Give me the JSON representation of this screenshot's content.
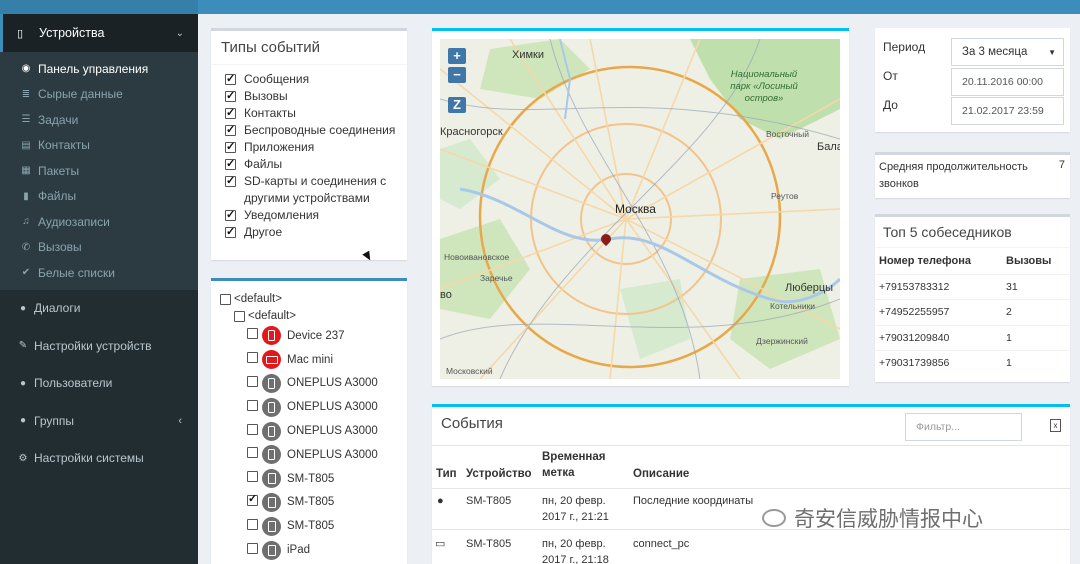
{
  "sidebar": {
    "header": {
      "label": "Устройства"
    },
    "sub_items": [
      {
        "label": "Панель управления",
        "icon": "dashboard-icon",
        "active": true
      },
      {
        "label": "Сырые данные",
        "icon": "database-icon"
      },
      {
        "label": "Задачи",
        "icon": "tasks-icon"
      },
      {
        "label": "Контакты",
        "icon": "contacts-icon"
      },
      {
        "label": "Пакеты",
        "icon": "packages-icon"
      },
      {
        "label": "Файлы",
        "icon": "file-icon"
      },
      {
        "label": "Аудиозаписи",
        "icon": "music-icon"
      },
      {
        "label": "Вызовы",
        "icon": "phone-icon"
      },
      {
        "label": "Белые списки",
        "icon": "check-icon"
      }
    ],
    "items": [
      {
        "label": "Диалоги",
        "icon": "comments-icon"
      },
      {
        "label": "Настройки устройств",
        "icon": "edit-icon"
      },
      {
        "label": "Пользователи",
        "icon": "user-icon"
      },
      {
        "label": "Группы",
        "icon": "users-icon"
      },
      {
        "label": "Настройки системы",
        "icon": "gear-icon"
      }
    ]
  },
  "event_types": {
    "title": "Типы событий",
    "items": [
      {
        "label": "Сообщения",
        "checked": true
      },
      {
        "label": "Вызовы",
        "checked": true
      },
      {
        "label": "Контакты",
        "checked": true
      },
      {
        "label": "Беспроводные соединения",
        "checked": true
      },
      {
        "label": "Приложения",
        "checked": true
      },
      {
        "label": "Файлы",
        "checked": true
      },
      {
        "label": "SD-карты и соединения с другими устройствами",
        "checked": true
      },
      {
        "label": "Уведомления",
        "checked": true
      },
      {
        "label": "Другое",
        "checked": true
      }
    ]
  },
  "device_tree": {
    "root": "<default>",
    "group": "<default>",
    "devices": [
      {
        "name": "Device 237",
        "icon": "phone-icon",
        "color": "#e3181d",
        "checked": false
      },
      {
        "name": "Mac mini",
        "icon": "monitor-icon",
        "color": "#e3181d",
        "checked": false
      },
      {
        "name": "ONEPLUS A3000",
        "icon": "phone-icon",
        "color": "#6f6f6f",
        "checked": false
      },
      {
        "name": "ONEPLUS A3000",
        "icon": "phone-icon",
        "color": "#6f6f6f",
        "checked": false
      },
      {
        "name": "ONEPLUS A3000",
        "icon": "phone-icon",
        "color": "#6f6f6f",
        "checked": false
      },
      {
        "name": "ONEPLUS A3000",
        "icon": "phone-icon",
        "color": "#6f6f6f",
        "checked": false
      },
      {
        "name": "SM-T805",
        "icon": "tablet-icon",
        "color": "#6f6f6f",
        "checked": false
      },
      {
        "name": "SM-T805",
        "icon": "tablet-icon",
        "color": "#6f6f6f",
        "checked": true
      },
      {
        "name": "SM-T805",
        "icon": "tablet-icon",
        "color": "#6f6f6f",
        "checked": false
      },
      {
        "name": "iPad",
        "icon": "tablet-icon",
        "color": "#6f6f6f",
        "checked": false
      }
    ]
  },
  "map": {
    "zoom_in": "+",
    "zoom_out": "−",
    "z_button": "Z",
    "labels": {
      "khimki": "Химки",
      "park": "Национальный парк «Лосиный остров»",
      "krasnogorsk": "Красногорск",
      "vostochny": "Восточный",
      "bala": "Бала",
      "moskva": "Москва",
      "reutov": "Реутов",
      "novoivankovskoe": "Новоивановское",
      "zarechye": "Заречье",
      "vo": "во",
      "lyubertsy": "Люберцы",
      "kotelniki": "Котельники",
      "dzerzhinsky": "Дзержинский",
      "moskovsky": "Московский"
    }
  },
  "period": {
    "period_label": "Период",
    "period_value": "За 3 месяца",
    "from_label": "От",
    "from_value": "20.11.2016 00:00",
    "to_label": "До",
    "to_value": "21.02.2017 23:59"
  },
  "avg_calls": {
    "label": "Средняя продолжительность звонков",
    "value": "7"
  },
  "top5": {
    "title": "Топ 5 собеседников",
    "col_phone": "Номер телефона",
    "col_calls": "Вызовы",
    "rows": [
      {
        "phone": "+79153783312",
        "calls": "31"
      },
      {
        "phone": "+74952255957",
        "calls": "2"
      },
      {
        "phone": "+79031209840",
        "calls": "1"
      },
      {
        "phone": "+79031739856",
        "calls": "1"
      }
    ]
  },
  "events": {
    "title": "События",
    "filter_placeholder": "Фильтр...",
    "headers": {
      "type": "Тип",
      "device": "Устройство",
      "timestamp": "Временная метка",
      "description": "Описание"
    },
    "rows": [
      {
        "icon": "map-marker-icon",
        "device": "SM-T805",
        "timestamp": "пн, 20 февр. 2017 г., 21:21",
        "description": "Последние координаты"
      },
      {
        "icon": "tablet-icon",
        "device": "SM-T805",
        "timestamp": "пн, 20 февр. 2017 г., 21:18",
        "description": "connect_pc"
      }
    ]
  },
  "watermark": "奇安信威胁情报中心"
}
